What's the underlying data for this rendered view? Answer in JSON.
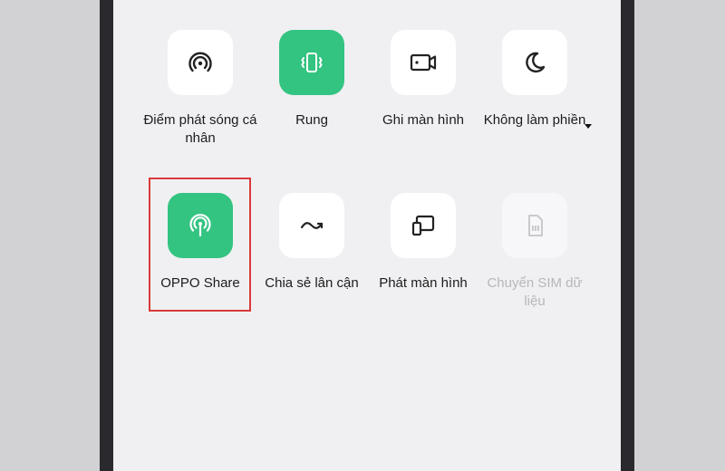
{
  "colors": {
    "active_tile": "#33c481",
    "tile": "#ffffff",
    "screen_bg": "#f0f0f3",
    "highlight_border": "#d93a3a"
  },
  "tiles": [
    {
      "label": "Điểm phát sóng cá nhân",
      "icon": "hotspot-icon",
      "state": "off"
    },
    {
      "label": "Rung",
      "icon": "vibrate-icon",
      "state": "on"
    },
    {
      "label": "Ghi màn hình",
      "icon": "screen-record-icon",
      "state": "off"
    },
    {
      "label": "Không làm phiền",
      "icon": "moon-icon",
      "state": "off"
    },
    {
      "label": "OPPO Share",
      "icon": "oppo-share-icon",
      "state": "on",
      "highlighted": true
    },
    {
      "label": "Chia sẻ lân cận",
      "icon": "nearby-share-icon",
      "state": "off"
    },
    {
      "label": "Phát màn hình",
      "icon": "screen-cast-icon",
      "state": "off"
    },
    {
      "label": "Chuyển SIM dữ liệu",
      "icon": "sim-card-icon",
      "state": "disabled"
    }
  ]
}
